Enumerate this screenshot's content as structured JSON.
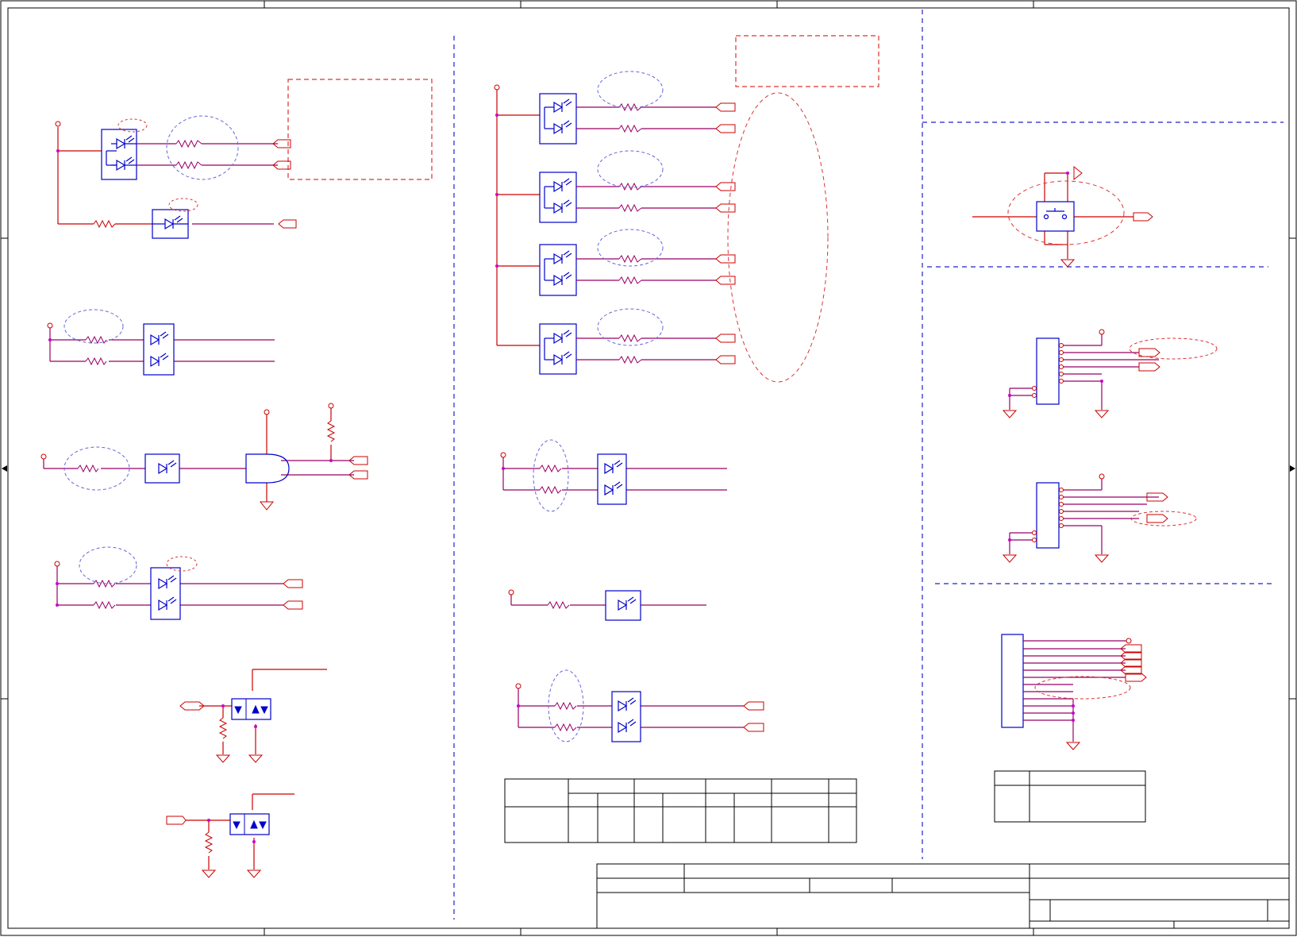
{
  "sheet": {
    "type": "electrical schematic sheet",
    "border_zones": {
      "columns": 5,
      "rows": 4
    },
    "text_labels": []
  },
  "colors": {
    "wire": "#cc0000",
    "component": "#0000cc",
    "net": "#990066",
    "junction": "#cc00cc",
    "border": "#000000",
    "annotation_blue": "#3333cc",
    "annotation_red": "#dd3333",
    "grid_divider": "#2222cc"
  },
  "icons": [
    "led-icon",
    "resistor-icon",
    "ground-icon",
    "power-pin-icon",
    "net-port-icon",
    "push-button-icon",
    "connector-icon",
    "and-gate-icon",
    "tvs-diode-icon"
  ],
  "sections": {
    "left_column": [
      "dual-led-group-1",
      "single-led-1",
      "dual-led-group-2",
      "led-and-gate",
      "dual-led-group-3",
      "tvs-protection-1",
      "tvs-protection-2"
    ],
    "middle_column": [
      "quad-dual-led-bank",
      "dual-led-group-4",
      "single-led-2",
      "dual-led-group-5",
      "revision-table"
    ],
    "right_column": [
      "push-button-switch",
      "connector-1",
      "connector-2",
      "connector-3",
      "legend-table"
    ]
  },
  "title_block": {
    "fields": []
  }
}
